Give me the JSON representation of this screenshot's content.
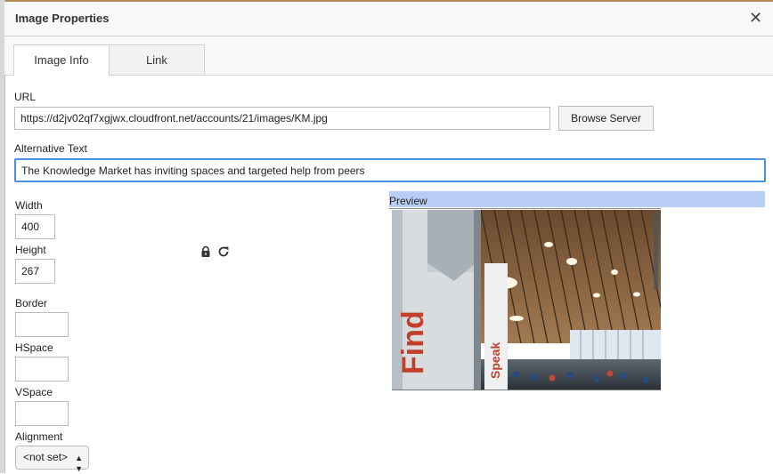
{
  "dialog": {
    "title": "Image Properties",
    "close_glyph": "✕"
  },
  "tabs": [
    {
      "label": "Image Info",
      "active": true
    },
    {
      "label": "Link",
      "active": false
    }
  ],
  "url": {
    "label": "URL",
    "value": "https://d2jv02qf7xgjwx.cloudfront.net/accounts/21/images/KM.jpg",
    "browse_label": "Browse Server"
  },
  "alt": {
    "label": "Alternative Text",
    "value": "The Knowledge Market has inviting spaces and targeted help from peers"
  },
  "dimensions": {
    "width_label": "Width",
    "width_value": "400",
    "height_label": "Height",
    "height_value": "267",
    "lock_icon": "lock-icon",
    "reset_icon": "reset-size-icon"
  },
  "border": {
    "label": "Border",
    "value": ""
  },
  "hspace": {
    "label": "HSpace",
    "value": ""
  },
  "vspace": {
    "label": "VSpace",
    "value": ""
  },
  "alignment": {
    "label": "Alignment",
    "selected": "<not set>"
  },
  "preview": {
    "label": "Preview",
    "sign_text_1": "Find",
    "sign_text_2": "Speak"
  },
  "colors": {
    "accent_focus": "#4a90e2",
    "preview_bar": "#b8cdf5"
  }
}
